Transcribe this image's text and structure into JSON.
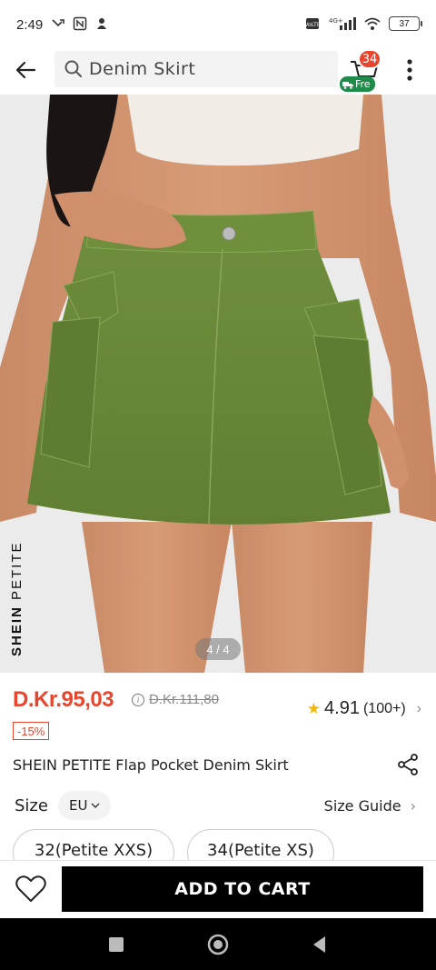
{
  "status_bar": {
    "time": "2:49",
    "network": "4G+",
    "battery": "37"
  },
  "search": {
    "query": "Denim Skirt"
  },
  "cart": {
    "count": "34",
    "free_label": "Fre"
  },
  "gallery": {
    "brand_bold": "SHEIN",
    "brand_light": " PETITE",
    "page_indicator": "4 / 4"
  },
  "price": {
    "current": "D.Kr.95,03",
    "original": "D.Kr.111,80",
    "discount": "-15%"
  },
  "rating": {
    "value": "4.91",
    "count": "(100+)"
  },
  "product": {
    "title": "SHEIN PETITE Flap Pocket Denim Skirt"
  },
  "size": {
    "label": "Size",
    "unit": "EU",
    "guide_label": "Size Guide",
    "options": [
      "32(Petite XXS)",
      "34(Petite XS)"
    ]
  },
  "actions": {
    "add_to_cart": "ADD TO CART"
  },
  "colors": {
    "price_accent": "#e8452c",
    "free_badge": "#1f8c4b",
    "skirt_green": "#6b8a3a",
    "rating_star": "#f6b700"
  }
}
